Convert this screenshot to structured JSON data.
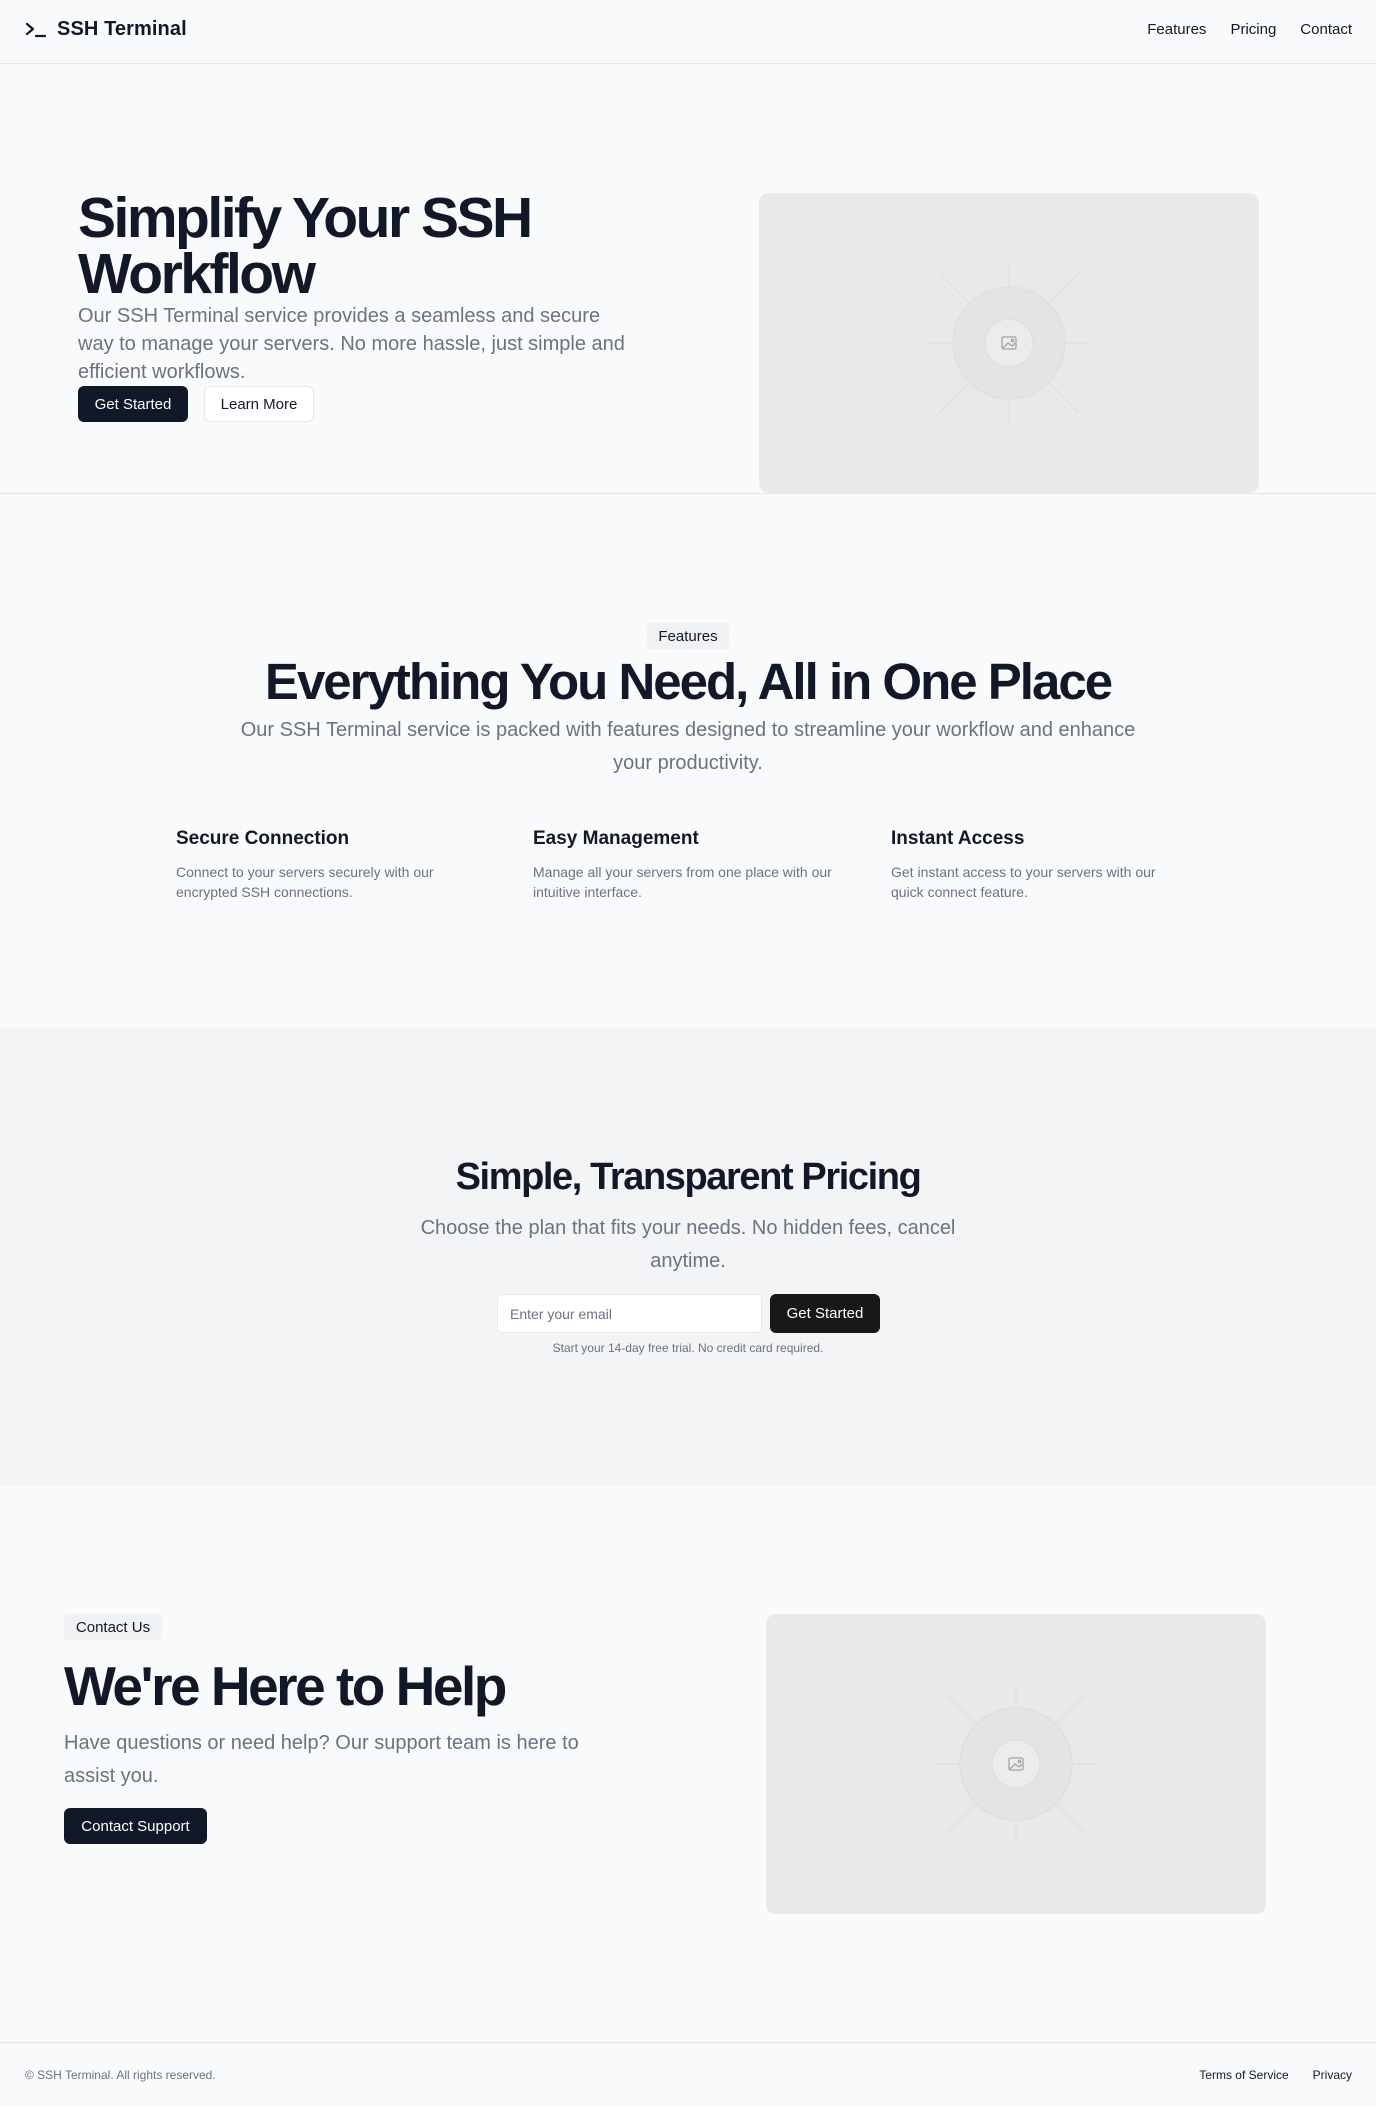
{
  "header": {
    "brand": "SSH Terminal",
    "nav": [
      "Features",
      "Pricing",
      "Contact"
    ]
  },
  "hero": {
    "title": "Simplify Your SSH Workflow",
    "description": "Our SSH Terminal service provides a seamless and secure way to manage your servers. No more hassle, just simple and efficient workflows.",
    "primary_button": "Get Started",
    "secondary_button": "Learn More"
  },
  "features": {
    "badge": "Features",
    "title": "Everything You Need, All in One Place",
    "description": "Our SSH Terminal service is packed with features designed to streamline your workflow and enhance your productivity.",
    "items": [
      {
        "title": "Secure Connection",
        "desc": "Connect to your servers securely with our encrypted SSH connections."
      },
      {
        "title": "Easy Management",
        "desc": "Manage all your servers from one place with our intuitive interface."
      },
      {
        "title": "Instant Access",
        "desc": "Get instant access to your servers with our quick connect feature."
      }
    ]
  },
  "pricing": {
    "title": "Simple, Transparent Pricing",
    "description": "Choose the plan that fits your needs. No hidden fees, cancel anytime.",
    "email_placeholder": "Enter your email",
    "button": "Get Started",
    "note": "Start your 14-day free trial. No credit card required."
  },
  "contact": {
    "badge": "Contact Us",
    "title": "We're Here to Help",
    "description": "Have questions or need help? Our support team is here to assist you.",
    "button": "Contact Support"
  },
  "footer": {
    "copyright": "© SSH Terminal. All rights reserved.",
    "links": [
      "Terms of Service",
      "Privacy"
    ]
  },
  "colors": {
    "background": "#f9fafb",
    "primary": "#111827",
    "muted_text": "#6b7280",
    "border": "#e5e7eb",
    "placeholder": "#e9e9e9"
  },
  "icons": {
    "brand": "terminal-prompt-icon",
    "placeholder": "image-icon"
  }
}
